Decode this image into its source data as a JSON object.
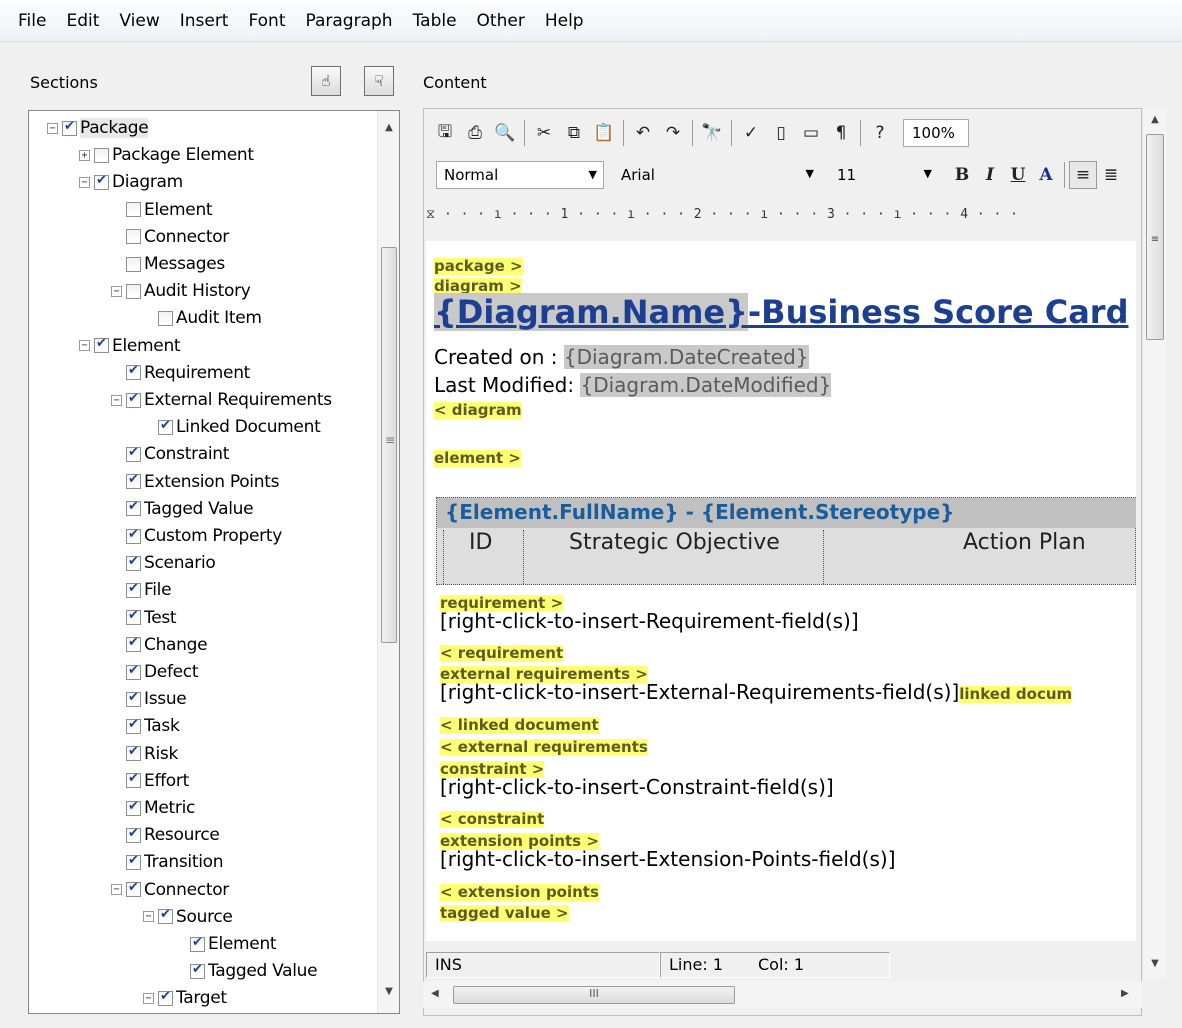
{
  "menu": [
    "File",
    "Edit",
    "View",
    "Insert",
    "Font",
    "Paragraph",
    "Table",
    "Other",
    "Help"
  ],
  "sections_label": "Sections",
  "content_label": "Content",
  "header_buttons": {
    "up_icon": "hand-up-icon",
    "down_icon": "hand-down-icon",
    "up_glyph": "☝",
    "down_glyph": "☟"
  },
  "tree": [
    {
      "label": "Package",
      "checked": true,
      "expander": "−",
      "selected": true
    },
    {
      "label": "Package Element",
      "checked": false,
      "expander": "+"
    },
    {
      "label": "Diagram",
      "checked": true,
      "expander": "−"
    },
    {
      "label": "Element",
      "checked": false,
      "expander": ""
    },
    {
      "label": "Connector",
      "checked": false,
      "expander": ""
    },
    {
      "label": "Messages",
      "checked": false,
      "expander": ""
    },
    {
      "label": "Audit History",
      "checked": false,
      "expander": "−"
    },
    {
      "label": "Audit Item",
      "checked": false,
      "expander": ""
    },
    {
      "label": "Element",
      "checked": true,
      "expander": "−"
    },
    {
      "label": "Requirement",
      "checked": true,
      "expander": ""
    },
    {
      "label": "External Requirements",
      "checked": true,
      "expander": "−"
    },
    {
      "label": "Linked Document",
      "checked": true,
      "expander": ""
    },
    {
      "label": "Constraint",
      "checked": true,
      "expander": ""
    },
    {
      "label": "Extension Points",
      "checked": true,
      "expander": ""
    },
    {
      "label": "Tagged Value",
      "checked": true,
      "expander": ""
    },
    {
      "label": "Custom Property",
      "checked": true,
      "expander": ""
    },
    {
      "label": "Scenario",
      "checked": true,
      "expander": ""
    },
    {
      "label": "File",
      "checked": true,
      "expander": ""
    },
    {
      "label": "Test",
      "checked": true,
      "expander": ""
    },
    {
      "label": "Change",
      "checked": true,
      "expander": ""
    },
    {
      "label": "Defect",
      "checked": true,
      "expander": ""
    },
    {
      "label": "Issue",
      "checked": true,
      "expander": ""
    },
    {
      "label": "Task",
      "checked": true,
      "expander": ""
    },
    {
      "label": "Risk",
      "checked": true,
      "expander": ""
    },
    {
      "label": "Effort",
      "checked": true,
      "expander": ""
    },
    {
      "label": "Metric",
      "checked": true,
      "expander": ""
    },
    {
      "label": "Resource",
      "checked": true,
      "expander": ""
    },
    {
      "label": "Transition",
      "checked": true,
      "expander": ""
    },
    {
      "label": "Connector",
      "checked": true,
      "expander": "−"
    },
    {
      "label": "Source",
      "checked": true,
      "expander": "−"
    },
    {
      "label": "Element",
      "checked": true,
      "expander": ""
    },
    {
      "label": "Tagged Value",
      "checked": true,
      "expander": ""
    },
    {
      "label": "Target",
      "checked": true,
      "expander": "−"
    }
  ],
  "toolbar": {
    "icons": [
      {
        "name": "save-icon",
        "glyph": "🖫"
      },
      {
        "name": "print-icon",
        "glyph": "⎙"
      },
      {
        "name": "print-preview-icon",
        "glyph": "🔍"
      },
      {
        "name": "cut-icon",
        "glyph": "✂"
      },
      {
        "name": "copy-icon",
        "glyph": "⧉"
      },
      {
        "name": "paste-icon",
        "glyph": "📋"
      },
      {
        "name": "undo-icon",
        "glyph": "↶"
      },
      {
        "name": "redo-icon",
        "glyph": "↷"
      },
      {
        "name": "find-icon",
        "glyph": "🔭"
      },
      {
        "name": "spellcheck-icon",
        "glyph": "✓"
      },
      {
        "name": "page-icon",
        "glyph": "▯"
      },
      {
        "name": "page-setup-icon",
        "glyph": "▭"
      },
      {
        "name": "pilcrow-icon",
        "glyph": "¶"
      },
      {
        "name": "help-icon",
        "glyph": "?"
      }
    ],
    "zoom": "100%"
  },
  "format_bar": {
    "style": "Normal",
    "font": "Arial",
    "size": "11",
    "bold": "B",
    "italic": "I",
    "underline": "U",
    "font_color": "A",
    "align_left_glyph": "≡",
    "align_center_glyph": "≣"
  },
  "ruler": "⧖ · · · ı · · · 1 · · · ı · · · 2 · · · ı · · · 3 · · · ı · · · 4 · · ·",
  "document": {
    "tag_package": "package >",
    "tag_diagram": "diagram >",
    "title_field": "{Diagram.Name}",
    "title_rest": "-Business Score Card",
    "created_label": "Created on : ",
    "created_field": "{Diagram.DateCreated}",
    "modified_label": "Last Modified: ",
    "modified_field": "{Diagram.DateModified}",
    "tag_diagram_end": "< diagram",
    "tag_element": "element >",
    "table_head_field": "{Element.FullName}",
    "table_head_rest": "  - {Element.Stereotype}",
    "col_id": "ID",
    "col_objective": "Strategic Objective",
    "col_action": "Action Plan",
    "tag_requirement": "requirement >",
    "req_placeholder": "[right-click-to-insert-Requirement-field(s)]",
    "tag_requirement_end": "< requirement",
    "tag_ext_req": "external requirements >",
    "ext_placeholder": "[right-click-to-insert-External-Requirements-field(s)]",
    "tag_linked_doc_inline": "linked docum",
    "tag_linked_doc_end": "< linked document",
    "tag_ext_req_end": "< external requirements",
    "tag_constraint": "constraint >",
    "con_placeholder": "[right-click-to-insert-Constraint-field(s)]",
    "tag_constraint_end": "< constraint",
    "tag_ext_points": "extension points >",
    "ext_pts_placeholder": "[right-click-to-insert-Extension-Points-field(s)]",
    "tag_ext_points_end": "< extension points",
    "tag_tagged_value": "tagged value >"
  },
  "status": {
    "mode": "INS",
    "line": "Line: 1",
    "col": "Col: 1"
  },
  "scroll": {
    "hscroll_grip": "III",
    "vscroll_grip": "≡"
  }
}
